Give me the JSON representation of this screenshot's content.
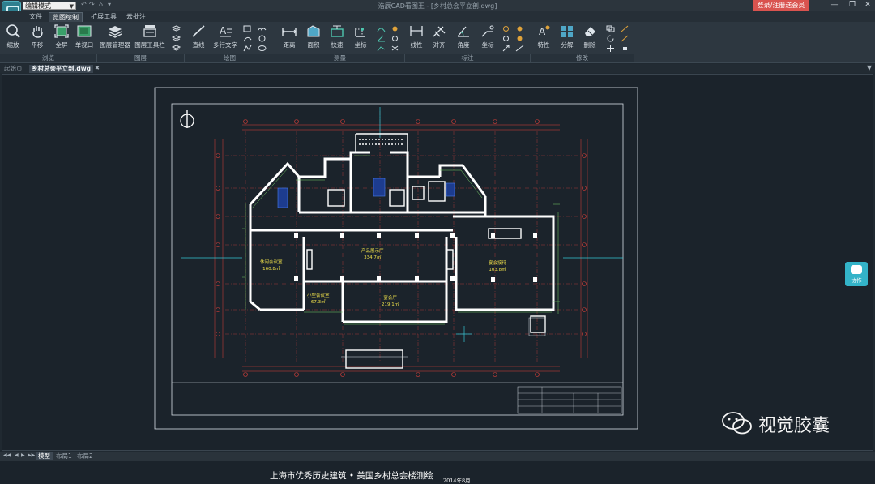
{
  "titlebar": {
    "mode_value": "编辑模式",
    "window_title": "浩辰CAD看图王 - [乡村总会平立剖.dwg]",
    "login_label": "登录/注册送会员",
    "minimize": "—",
    "restore": "❐",
    "close": "✕"
  },
  "menu": {
    "tabs": [
      "文件",
      "览图绘制",
      "扩展工具",
      "云批注"
    ],
    "active": "览图绘制"
  },
  "ribbon": {
    "buttons": {
      "zoom": "缩放",
      "pan": "平移",
      "fullscreen": "全屏",
      "single_viewport": "单视口",
      "layer_manager": "图层管理器",
      "layer_toolbar": "图层工具栏",
      "line": "直线",
      "mtext": "多行文字",
      "distance": "距离",
      "area": "面积",
      "fast": "快速",
      "coordinate": "坐标",
      "linear": "线性",
      "aligned": "对齐",
      "angle": "角度",
      "dim_coordinate": "坐标",
      "properties": "特性",
      "explode": "分解",
      "delete": "删除"
    },
    "groups": {
      "browse": "浏览",
      "layer": "图层",
      "draw": "绘图",
      "measure": "测量",
      "annotate": "标注",
      "modify": "修改"
    }
  },
  "doc_tabs": {
    "start": "起始页",
    "file": "乡村总会平立剖.dwg"
  },
  "layout_tabs": [
    "模型",
    "布局1",
    "布局2"
  ],
  "active_layout": "模型",
  "side_button": {
    "label": "协作"
  },
  "drawing": {
    "title": "上海市优秀历史建筑 • 美国乡村总会楼测绘",
    "date": "2014年8月",
    "rooms": [
      {
        "name": "产品展示厅",
        "area": "334.7㎡"
      },
      {
        "name": "休闲会议室",
        "area": "160.8㎡"
      },
      {
        "name": "小型会议室",
        "area": "67.3㎡"
      },
      {
        "name": "宴会厅",
        "area": "219.1㎡"
      },
      {
        "name": "宴会接待",
        "area": "103.8㎡"
      }
    ]
  },
  "watermark": {
    "text": "视觉胶囊"
  },
  "colors": {
    "background": "#1b232b",
    "ribbon": "#2d3740",
    "accent": "#33b3c8",
    "login": "#d9534f",
    "wall": "#ffffff",
    "axis_red": "#e0403a",
    "dim_green": "#7ad36b",
    "text_yellow": "#f0e14a"
  }
}
